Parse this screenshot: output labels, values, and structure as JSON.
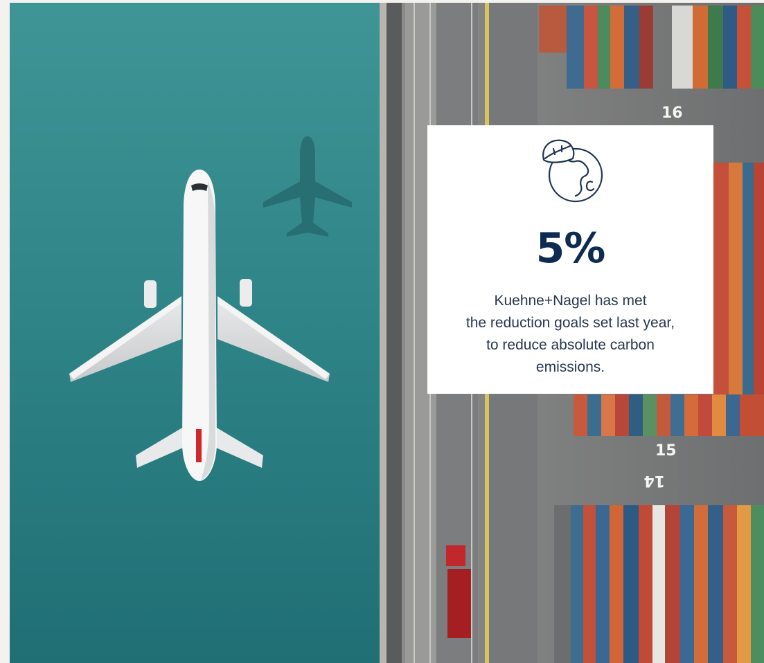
{
  "stat_card": {
    "icon": "leaf-globe-icon",
    "value": "5%",
    "description_lines": [
      "Kuehne+Nagel has met",
      "the reduction goals set last year,",
      "to reduce absolute carbon",
      "emissions."
    ]
  },
  "photo": {
    "berth_labels": [
      "16",
      "15",
      "14"
    ]
  },
  "colors": {
    "sea": "#3b8e8e",
    "card_bg": "#ffffff",
    "value_text": "#0e2b52",
    "body_text": "#27374f",
    "page_bg": "#f3f2ee"
  }
}
